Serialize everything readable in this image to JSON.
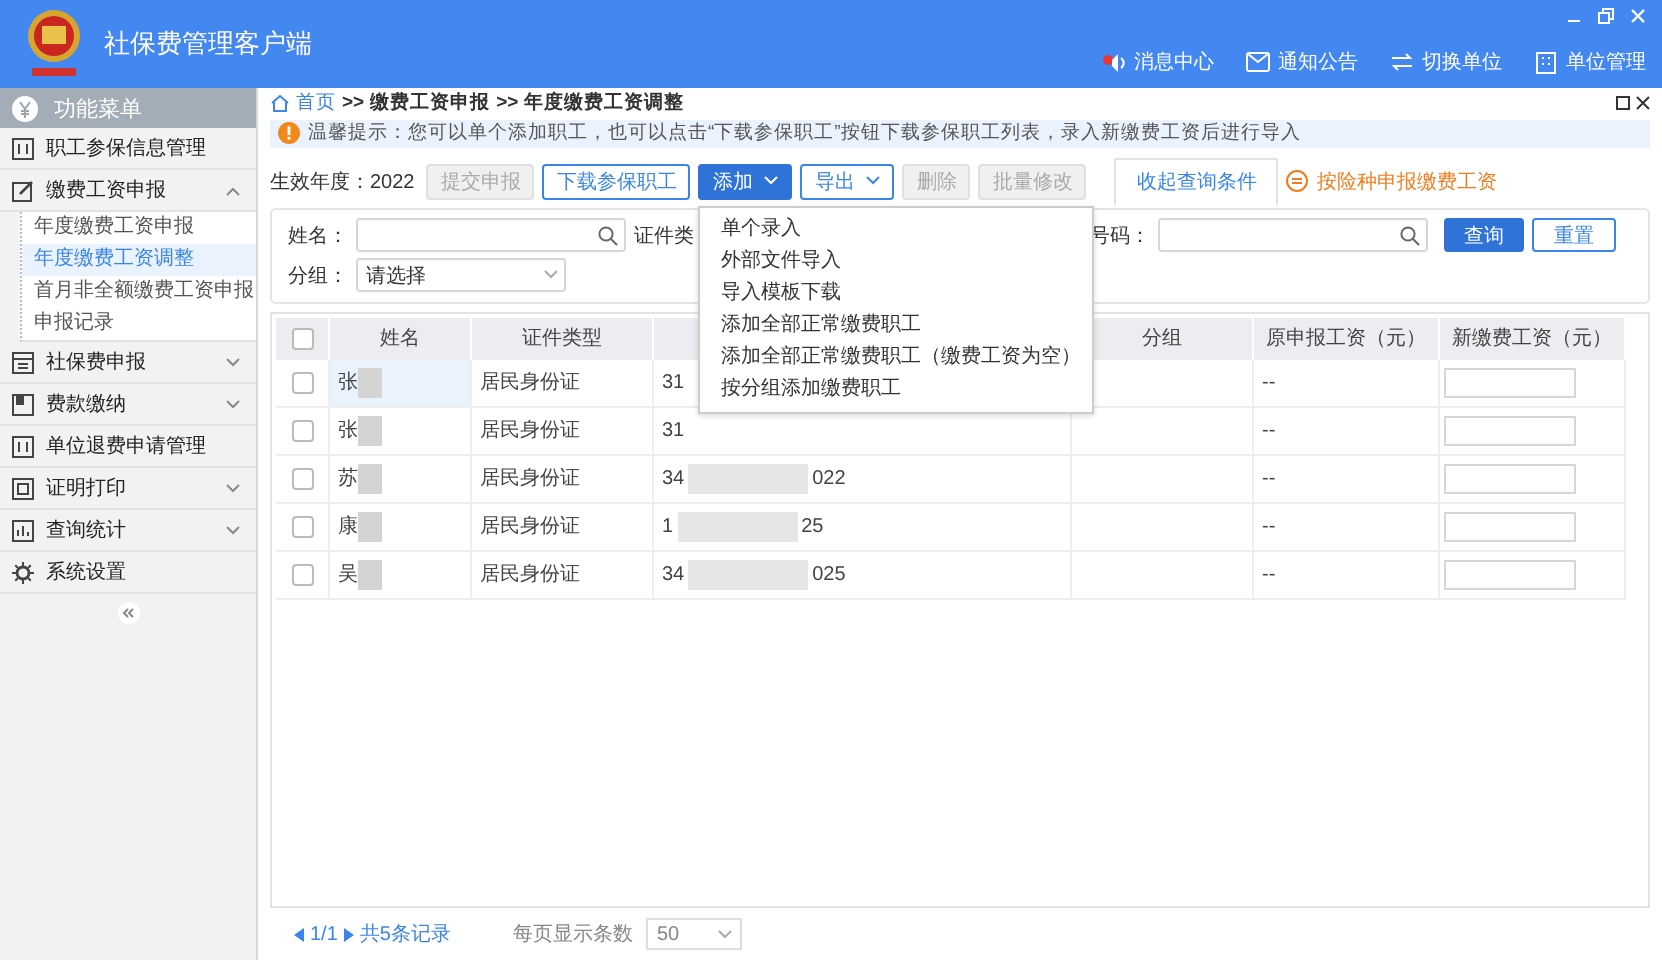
{
  "window": {
    "title": "社保费管理客户端"
  },
  "header_links": [
    {
      "label": "消息中心"
    },
    {
      "label": "通知公告"
    },
    {
      "label": "切换单位"
    },
    {
      "label": "单位管理"
    }
  ],
  "sidebar": {
    "title": "功能菜单",
    "items": [
      {
        "label": "职工参保信息管理",
        "kind": "link"
      },
      {
        "label": "缴费工资申报",
        "kind": "group",
        "expanded": true,
        "children": [
          {
            "label": "年度缴费工资申报",
            "selected": false
          },
          {
            "label": "年度缴费工资调整",
            "selected": true
          },
          {
            "label": "首月非全额缴费工资申报",
            "selected": false
          },
          {
            "label": "申报记录",
            "selected": false
          }
        ]
      },
      {
        "label": "社保费申报",
        "kind": "group",
        "expanded": false
      },
      {
        "label": "费款缴纳",
        "kind": "group",
        "expanded": false
      },
      {
        "label": "单位退费申请管理",
        "kind": "link"
      },
      {
        "label": "证明打印",
        "kind": "group",
        "expanded": false
      },
      {
        "label": "查询统计",
        "kind": "group",
        "expanded": false
      },
      {
        "label": "系统设置",
        "kind": "link"
      }
    ]
  },
  "breadcrumb": [
    {
      "label": "首页",
      "kind": "link"
    },
    {
      "label": ">>",
      "kind": "separator"
    },
    {
      "label": "缴费工资申报",
      "kind": "text"
    },
    {
      "label": ">>",
      "kind": "separator"
    },
    {
      "label": "年度缴费工资调整",
      "kind": "text"
    }
  ],
  "tip": "温馨提示：您可以单个添加职工，也可以点击“下载参保职工”按钮下载参保职工列表，录入新缴费工资后进行导入",
  "toolbar": {
    "year_label": "生效年度：",
    "year": "2022",
    "buttons": [
      {
        "label": "提交申报",
        "kind": "disabled",
        "dropdown": false
      },
      {
        "label": "下载参保职工",
        "kind": "outline",
        "dropdown": false
      },
      {
        "label": "添加",
        "kind": "primary",
        "dropdown": true
      },
      {
        "label": "导出",
        "kind": "outline",
        "dropdown": true
      },
      {
        "label": "删除",
        "kind": "disabled",
        "dropdown": false
      },
      {
        "label": "批量修改",
        "kind": "disabled",
        "dropdown": false
      }
    ]
  },
  "filter_toggle": {
    "label": "收起查询条件",
    "expanded": true
  },
  "switch_link": {
    "label": "按险种申报缴费工资"
  },
  "dropdown_menu": {
    "items": [
      "单个录入",
      "外部文件导入",
      "导入模板下载",
      "添加全部正常缴费职工",
      "添加全部正常缴费职工（缴费工资为空）",
      "按分组添加缴费职工"
    ]
  },
  "filters": {
    "name_label": "姓名：",
    "id_type_label": "证件类",
    "id_number_label": "号码：",
    "group_label": "分组：",
    "group_placeholder": "请选择",
    "search": "查询",
    "reset": "重置"
  },
  "table": {
    "all_checked": false,
    "columns": [
      {
        "label": "姓名",
        "kind": "text"
      },
      {
        "label": "证件类型",
        "kind": "text"
      },
      {
        "kind": "covered"
      },
      {
        "label": "分组",
        "kind": "text"
      },
      {
        "label": "原申报工资（元）",
        "kind": "text"
      },
      {
        "label": "新缴费工资（元）",
        "kind": "text"
      }
    ],
    "rows": [
      {
        "checked": false,
        "name": "张",
        "id_type": "居民身份证",
        "id_start": "31",
        "original_wage": "--"
      },
      {
        "checked": false,
        "name": "张",
        "id_type": "居民身份证",
        "id_start": "31",
        "original_wage": "--"
      },
      {
        "checked": false,
        "name": "苏",
        "id_type": "居民身份证",
        "id_start": "34",
        "id_end": "022",
        "original_wage": "--"
      },
      {
        "checked": false,
        "name": "康",
        "id_type": "居民身份证",
        "id_start": "1",
        "id_end": "25",
        "original_wage": "--"
      },
      {
        "checked": false,
        "name": "吴",
        "id_type": "居民身份证",
        "id_start": "34",
        "id_end": "025",
        "original_wage": "--"
      }
    ]
  },
  "pagination": {
    "page": "1/1",
    "total": "共5条记录",
    "page_size_label": "每页显示条数",
    "page_size": "50"
  }
}
